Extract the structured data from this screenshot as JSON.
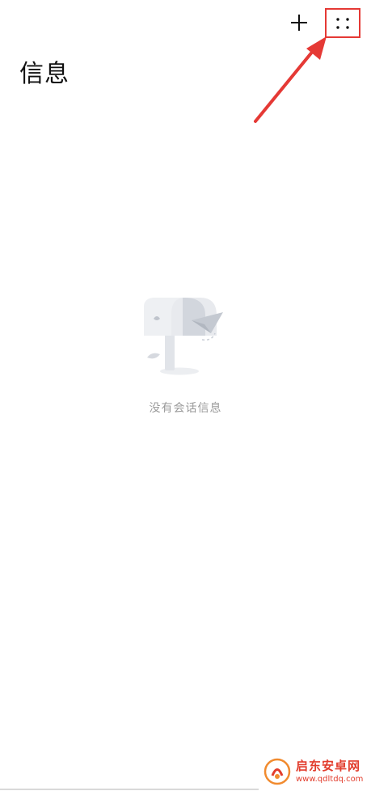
{
  "header": {
    "title": "信息",
    "add_icon": "plus-icon",
    "more_icon": "four-dots-icon"
  },
  "empty_state": {
    "message": "没有会话信息",
    "illustration": "mailbox-illustration"
  },
  "colors": {
    "highlight": "#e53935",
    "text_muted": "#9a9a9a",
    "watermark": "#e23d2d"
  },
  "watermark": {
    "title": "启东安卓网",
    "url": "www.qdltdq.com"
  }
}
